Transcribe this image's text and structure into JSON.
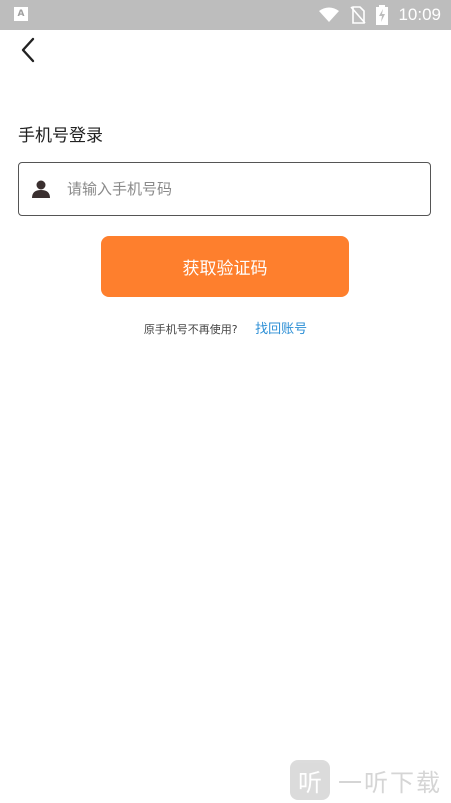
{
  "status_bar": {
    "app_icon_letter": "A",
    "time": "10:09",
    "icons": [
      "wifi-icon",
      "no-sim-icon",
      "battery-charging-icon"
    ]
  },
  "header": {
    "back_icon": "chevron-left-icon"
  },
  "login": {
    "title": "手机号登录",
    "phone_placeholder": "请输入手机号码",
    "phone_value": "",
    "get_code_label": "获取验证码",
    "help_text": "原手机号不再使用?",
    "recover_link": "找回账号"
  },
  "watermark": {
    "logo_char": "听",
    "text": "一听下载"
  },
  "colors": {
    "accent": "#fe7f2d",
    "link": "#2c8fd6",
    "status_bar": "#bdbdbd"
  }
}
